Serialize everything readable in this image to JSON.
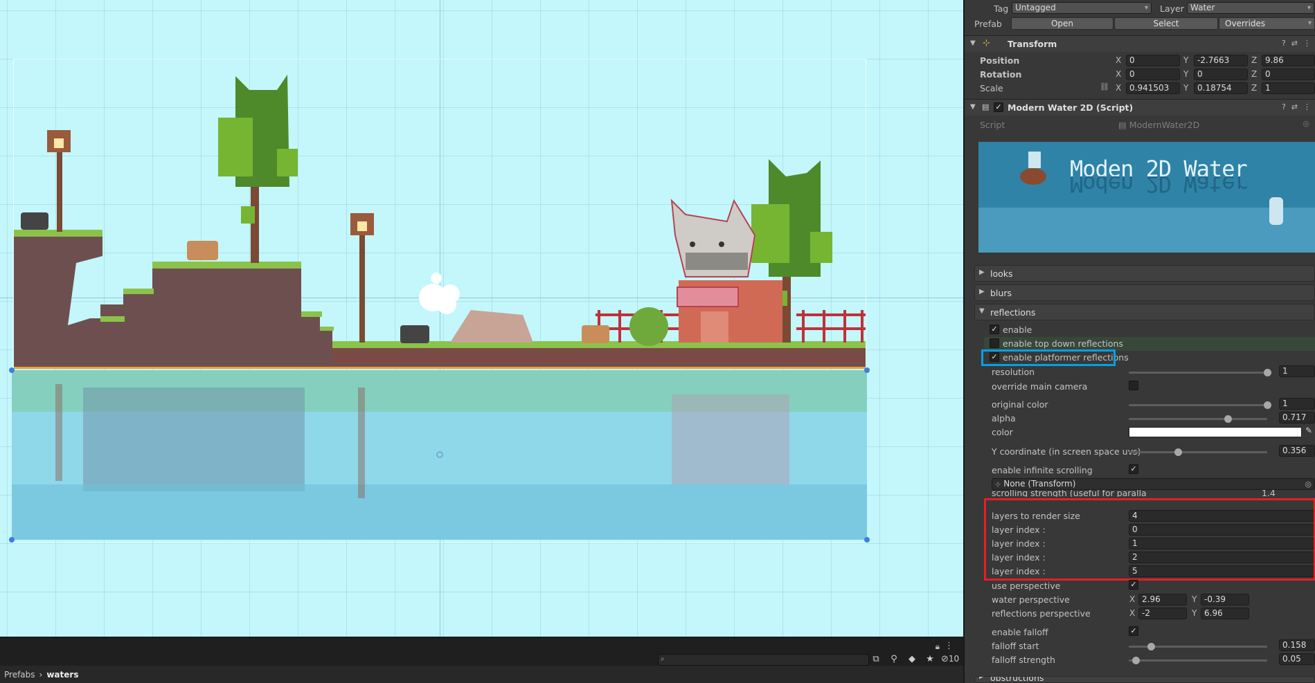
{
  "scene": {
    "breadcrumb": [
      "Prefabs",
      "waters"
    ],
    "breadcrumb_separator": "›",
    "search_placeholder": "",
    "hidden_count": "10"
  },
  "inspector": {
    "tag_label": "Tag",
    "tag_value": "Untagged",
    "layer_label": "Layer",
    "layer_value": "Water",
    "prefab_label": "Prefab",
    "prefab_open": "Open",
    "prefab_select": "Select",
    "prefab_overrides": "Overrides",
    "transform": {
      "title": "Transform",
      "position_label": "Position",
      "rotation_label": "Rotation",
      "scale_label": "Scale",
      "position": {
        "x": "0",
        "y": "-2.7663",
        "z": "9.86"
      },
      "rotation": {
        "x": "0",
        "y": "0",
        "z": "0"
      },
      "scale": {
        "x": "0.941503",
        "y": "0.18754",
        "z": "1"
      }
    },
    "script_component": {
      "title": "Modern Water 2D (Script)",
      "script_label": "Script",
      "script_value": "ModernWater2D",
      "banner_text": "Moden 2D Water"
    },
    "foldouts": {
      "looks": "looks",
      "blurs": "blurs",
      "reflections": "reflections",
      "obstructions": "obstructions"
    },
    "reflections": {
      "enable_label": "enable",
      "enable_top_down_label": "enable top down reflections",
      "enable_platformer_label": "enable platformer reflections",
      "resolution_label": "resolution",
      "resolution_value": "1",
      "resolution_fraction": 1.0,
      "override_main_camera_label": "override main camera",
      "original_color_label": "original color",
      "original_color_value": "1",
      "original_color_fraction": 1.0,
      "alpha_label": "alpha",
      "alpha_value": "0.717",
      "alpha_fraction": 0.717,
      "color_label": "color",
      "color_hex": "#ffffff",
      "y_coord_label": "Y coordinate (in screen space uvs)",
      "y_coord_value": "0.356",
      "y_coord_fraction": 0.356,
      "infinite_scrolling_label": "enable infinite scrolling",
      "transform_ref": "None (Transform)",
      "scrolling_strength_label": "scrolling strength (useful for paralla",
      "scrolling_strength_value": "1.4",
      "layers_size_label": "layers to render size",
      "layers_size_value": "4",
      "layer_index_label": "layer index :",
      "layer_indices": [
        "0",
        "1",
        "2",
        "5"
      ],
      "use_perspective_label": "use perspective",
      "water_perspective_label": "water perspective",
      "water_perspective": {
        "x": "2.96",
        "y": "-0.39"
      },
      "reflections_perspective_label": "reflections perspective",
      "reflections_perspective": {
        "x": "-2",
        "y": "6.96"
      },
      "enable_falloff_label": "enable falloff",
      "falloff_start_label": "falloff start",
      "falloff_start_value": "0.158",
      "falloff_start_fraction": 0.158,
      "falloff_strength_label": "falloff strength",
      "falloff_strength_value": "0.05",
      "falloff_strength_fraction": 0.05
    }
  },
  "colors": {
    "sky": "#c3f7fb",
    "inspector_bg": "#383838",
    "highlight_blue": "#00a2e8",
    "highlight_red": "#ed1c24"
  }
}
